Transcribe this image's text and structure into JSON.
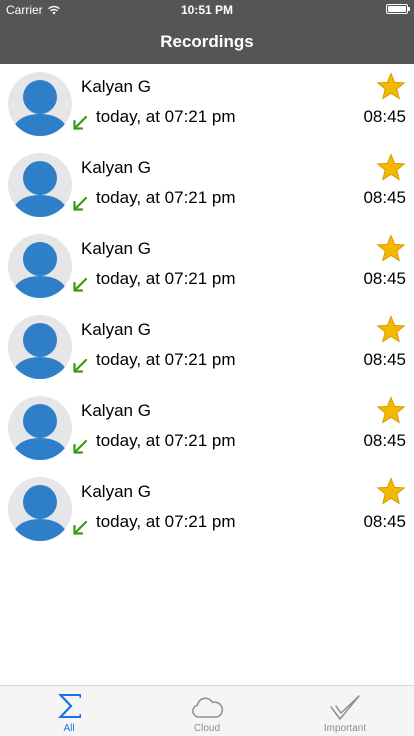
{
  "status_bar": {
    "carrier": "Carrier",
    "time": "10:51 PM"
  },
  "nav": {
    "title": "Recordings"
  },
  "recordings": [
    {
      "name": "Kalyan G",
      "timestamp": "today, at 07:21 pm",
      "duration": "08:45",
      "starred": true,
      "call_icon": "incoming-call-arrow-icon"
    },
    {
      "name": "Kalyan G",
      "timestamp": "today, at 07:21 pm",
      "duration": "08:45",
      "starred": true,
      "call_icon": "incoming-call-arrow-icon"
    },
    {
      "name": "Kalyan G",
      "timestamp": "today, at 07:21 pm",
      "duration": "08:45",
      "starred": true,
      "call_icon": "incoming-call-arrow-icon"
    },
    {
      "name": "Kalyan G",
      "timestamp": "today, at 07:21 pm",
      "duration": "08:45",
      "starred": true,
      "call_icon": "incoming-call-arrow-icon"
    },
    {
      "name": "Kalyan G",
      "timestamp": "today, at 07:21 pm",
      "duration": "08:45",
      "starred": true,
      "call_icon": "incoming-call-arrow-icon"
    },
    {
      "name": "Kalyan G",
      "timestamp": "today, at 07:21 pm",
      "duration": "08:45",
      "starred": true,
      "call_icon": "incoming-call-arrow-icon"
    }
  ],
  "tabs": [
    {
      "label": "All",
      "icon": "sigma-icon",
      "active": true
    },
    {
      "label": "Cloud",
      "icon": "cloud-icon",
      "active": false
    },
    {
      "label": "Important",
      "icon": "checkmark-icon",
      "active": false
    }
  ],
  "colors": {
    "bar_background": "#555555",
    "avatar_blue": "#2f7fc8",
    "star_gold": "#f5b800",
    "incoming_arrow_green": "#3a9a12",
    "tab_active": "#1a73e8",
    "tab_inactive": "#8e8e93"
  }
}
